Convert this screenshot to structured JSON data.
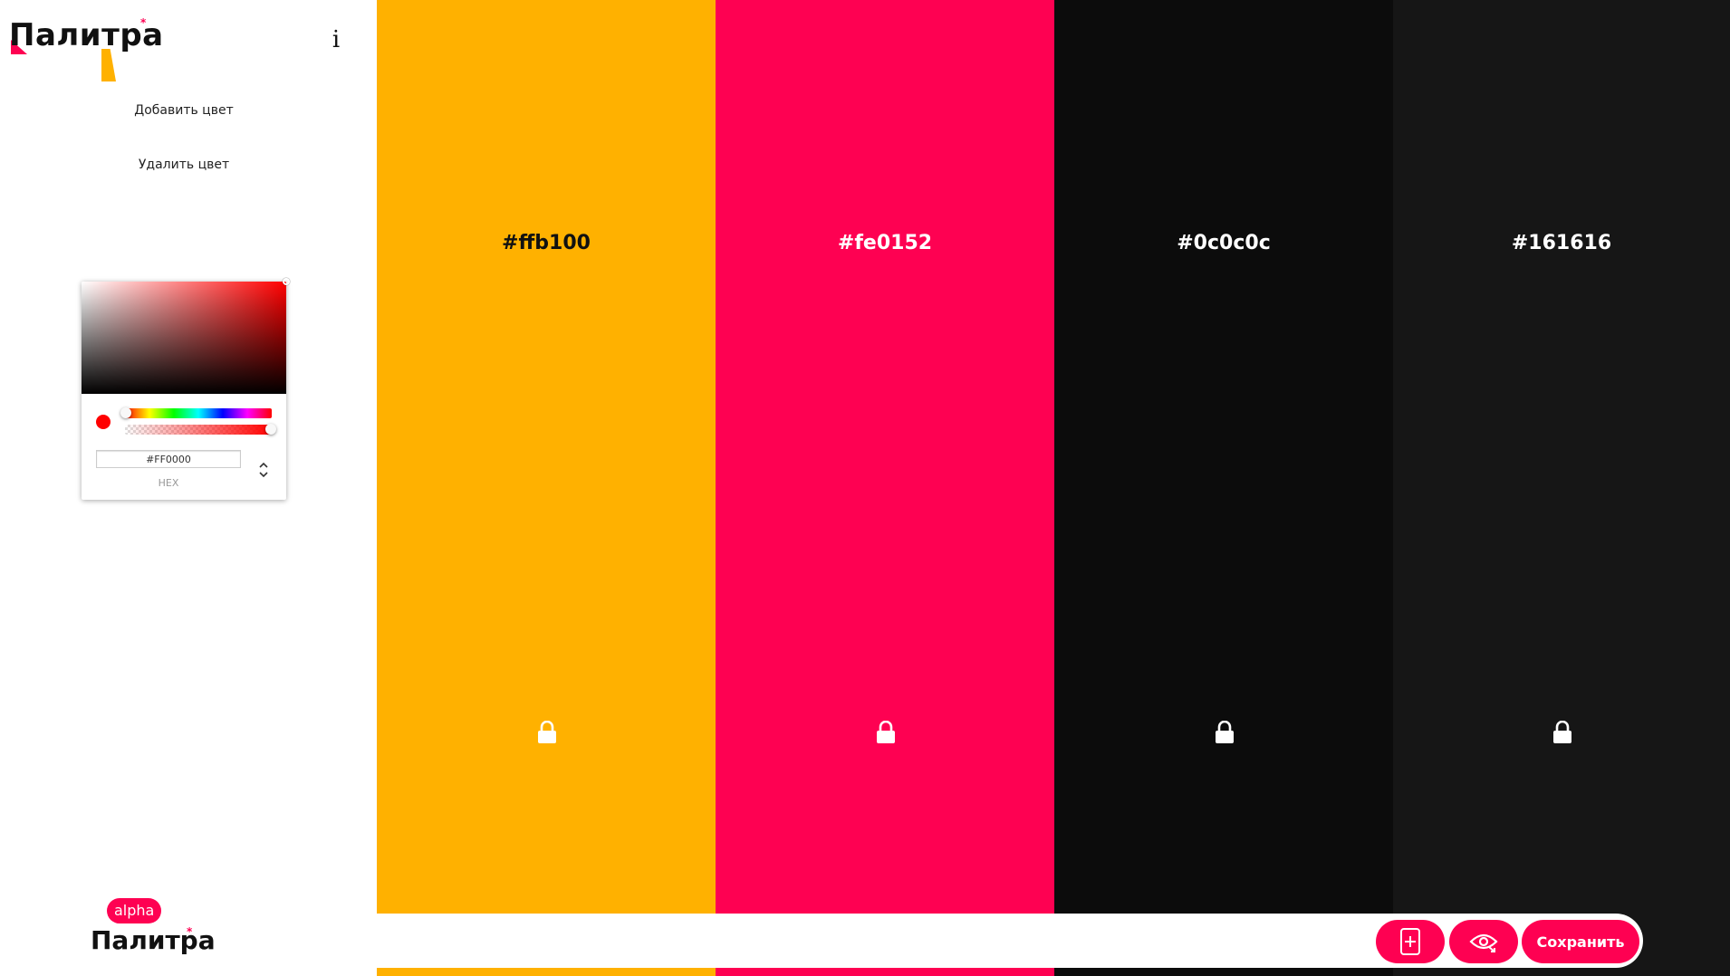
{
  "app": {
    "logo_text": "Палитра",
    "info_label": "i",
    "alpha_badge": "alpha"
  },
  "sidebar": {
    "add_color": "Добавить цвет",
    "remove_color": "Удалить цвет"
  },
  "picker": {
    "hex_value": "#FF0000",
    "mode_label": "HEX",
    "current_color": "#ff0000",
    "alpha": 1.0
  },
  "columns": [
    {
      "hex": "#ffb100",
      "background": "#ffb100",
      "text_color": "#111111",
      "lock_icon": "lock-icon"
    },
    {
      "hex": "#fe0152",
      "background": "#fe0152",
      "text_color": "#ffffff",
      "lock_icon": "lock-icon"
    },
    {
      "hex": "#0c0c0c",
      "background": "#0c0c0c",
      "text_color": "#ffffff",
      "lock_icon": "lock-icon"
    },
    {
      "hex": "#161616",
      "background": "#161616",
      "text_color": "#ffffff",
      "lock_icon": "lock-icon"
    }
  ],
  "toolbar": {
    "add_icon": "add-page-icon",
    "preview_icon": "eye-icon",
    "save_label": "Сохранить"
  },
  "colors": {
    "accent": "#fe0152",
    "yellow": "#ffb100"
  }
}
